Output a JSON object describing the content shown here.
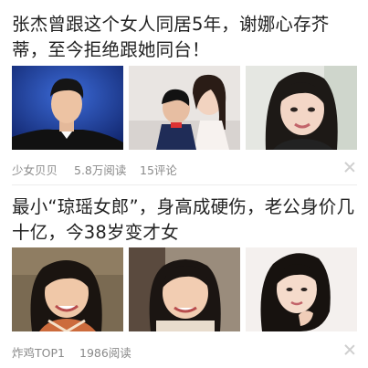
{
  "feed": [
    {
      "title": "张杰曾跟这个女人同居5年，谢娜心存芥蒂，至今拒绝跟她同台！",
      "source": "少女贝贝",
      "reads": "5.8万阅读",
      "comments": "15评论",
      "close_icon": "close-icon"
    },
    {
      "title": "最小“琼瑶女郎”，身高成硬伤，老公身价几十亿，今38岁变才女",
      "source": "炸鸡TOP1",
      "reads": "1986阅读",
      "close_icon": "close-icon"
    }
  ],
  "colors": {
    "title": "#222222",
    "meta": "#8a8a8a",
    "divider": "#ececec",
    "stage_blue": "#1e3f9a"
  }
}
